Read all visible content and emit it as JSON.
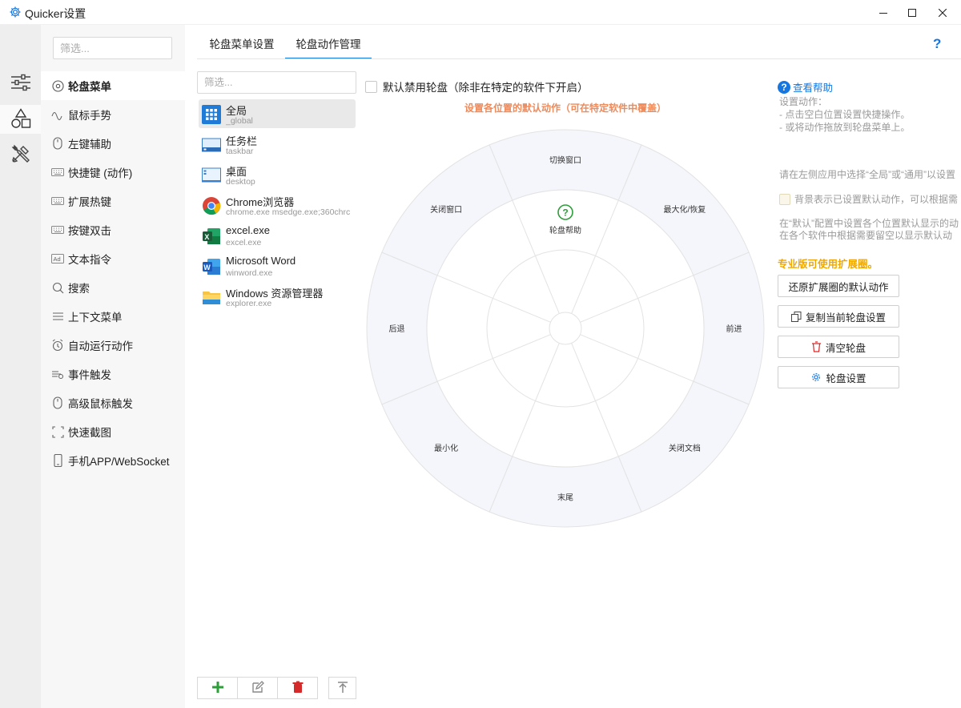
{
  "window": {
    "title": "Quicker设置",
    "icon": "gear-icon",
    "controls": [
      "minimize-icon",
      "maximize-icon",
      "close-icon"
    ]
  },
  "rail": {
    "items": [
      {
        "icon": "sliders-icon",
        "active": false
      },
      {
        "icon": "shapes-icon",
        "active": true
      },
      {
        "icon": "tools-icon",
        "active": false
      }
    ]
  },
  "nav": {
    "filter_placeholder": "筛选...",
    "items": [
      {
        "label": "轮盘菜单",
        "icon": "wheel-icon",
        "active": true
      },
      {
        "label": "鼠标手势",
        "icon": "gesture-wave-icon"
      },
      {
        "label": "左键辅助",
        "icon": "mouse-icon"
      },
      {
        "label": "快捷键 (动作)",
        "icon": "keyboard-icon"
      },
      {
        "label": "扩展热键",
        "icon": "keyboard-icon"
      },
      {
        "label": "按键双击",
        "icon": "keyboard-icon"
      },
      {
        "label": "文本指令",
        "icon": "ad-text-icon"
      },
      {
        "label": "搜索",
        "icon": "search-icon"
      },
      {
        "label": "上下文菜单",
        "icon": "menu-lines-icon"
      },
      {
        "label": "自动运行动作",
        "icon": "alarm-clock-icon"
      },
      {
        "label": "事件触发",
        "icon": "event-icon"
      },
      {
        "label": "高级鼠标触发",
        "icon": "mouse-icon"
      },
      {
        "label": "快速截图",
        "icon": "screenshot-icon"
      },
      {
        "label": "手机APP/WebSocket",
        "icon": "phone-icon"
      }
    ]
  },
  "tabs": [
    {
      "label": "轮盘菜单设置",
      "active": false
    },
    {
      "label": "轮盘动作管理",
      "active": true
    }
  ],
  "apps": {
    "filter_placeholder": "筛选...",
    "items": [
      {
        "name": "全局",
        "sub": "_global",
        "icon": "global-grid-icon",
        "active": true
      },
      {
        "name": "任务栏",
        "sub": "taskbar",
        "icon": "taskbar-icon"
      },
      {
        "name": "桌面",
        "sub": "desktop",
        "icon": "desktop-icon"
      },
      {
        "name": "Chrome浏览器",
        "sub": "chrome.exe  msedge.exe;360chrc",
        "icon": "chrome-icon"
      },
      {
        "name": "excel.exe",
        "sub": "excel.exe",
        "icon": "excel-icon"
      },
      {
        "name": "Microsoft Word",
        "sub": "winword.exe",
        "icon": "word-icon"
      },
      {
        "name": "Windows 资源管理器",
        "sub": "explorer.exe",
        "icon": "folder-icon"
      }
    ]
  },
  "bottom_tools": [
    {
      "icon": "add-icon"
    },
    {
      "icon": "edit-icon"
    },
    {
      "icon": "delete-icon"
    },
    {
      "icon": "move-top-icon"
    }
  ],
  "wheel": {
    "disable_label": "默认禁用轮盘（除非在特定的软件下开启）",
    "caption": "设置各位置的默认动作（可在特定软件中覆盖）",
    "inner_center_label": "轮盘帮助",
    "inner_center_icon": "question-circle-icon",
    "outer_labels": {
      "top": "切换窗口",
      "top_right": "最大化/恢复",
      "right": "前进",
      "bottom_right": "关闭文档",
      "bottom": "末尾",
      "bottom_left": "最小化",
      "left": "后退",
      "top_left": "关闭窗口"
    }
  },
  "right_panel": {
    "help_link": "查看帮助",
    "lines": [
      "设置动作：",
      "- 点击空白位置设置快捷操作。",
      "- 或将动作拖放到轮盘菜单上。",
      "请在左侧应用中选择“全局”或“通用”以设置",
      "在“默认”配置中设置各个位置默认显示的动",
      "在各个软件中根据需要留空以显示默认动"
    ],
    "bg_checkbox": "背景表示已设置默认动作，可以根据需",
    "pro_note": "专业版可使用扩展圈。",
    "buttons": [
      {
        "label": "还原扩展圈的默认动作",
        "icon": ""
      },
      {
        "label": "复制当前轮盘设置",
        "icon": "copy-icon"
      },
      {
        "label": "清空轮盘",
        "icon": "trash-icon"
      },
      {
        "label": "轮盘设置",
        "icon": "gear-icon"
      }
    ]
  },
  "colors": {
    "accent": "#1677e0",
    "caption": "#ef8a5a",
    "pro": "#f0a800",
    "wheel_fill": "#f5f6fb"
  }
}
